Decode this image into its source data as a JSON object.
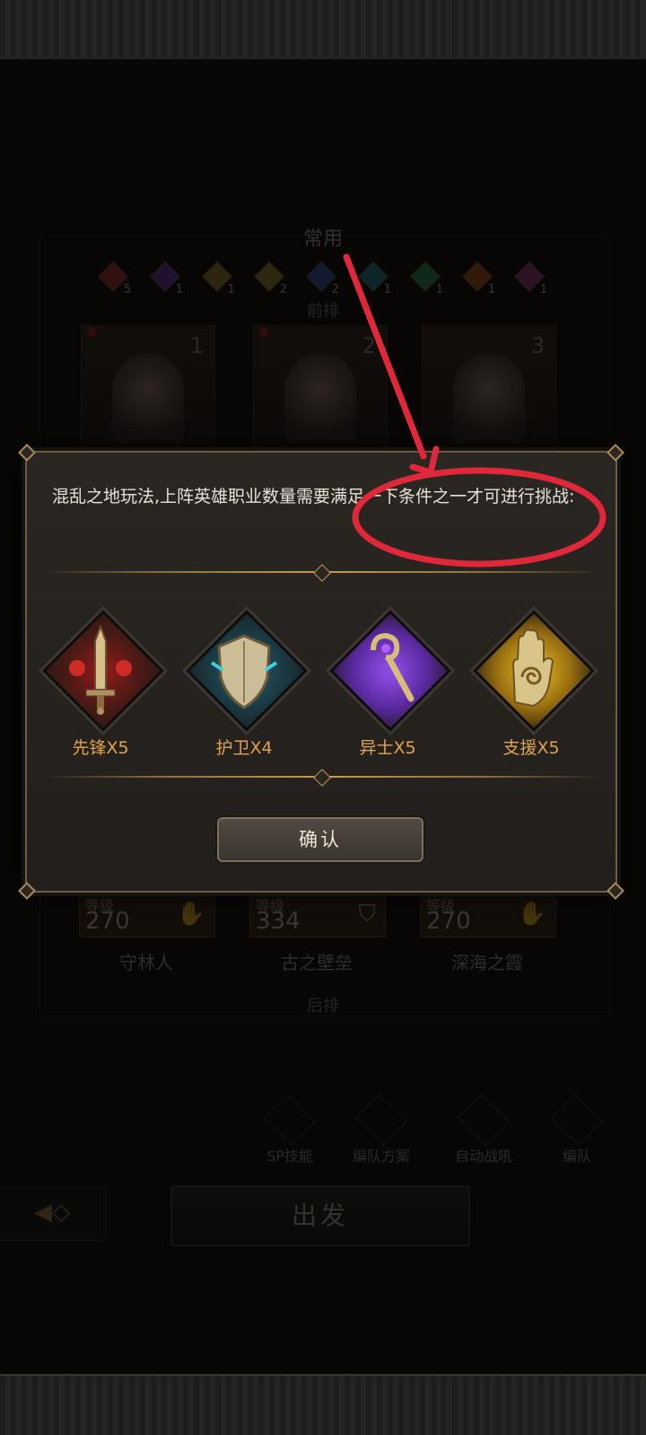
{
  "formation": {
    "section_title": "常用",
    "front_label": "前排",
    "back_label": "后排",
    "class_counts": [
      {
        "icon": "vanguard-red-icon",
        "count": "5",
        "color": "#b83a2a"
      },
      {
        "icon": "mage-purple-icon",
        "count": "1",
        "color": "#7a3ab0"
      },
      {
        "icon": "ranger-gold-icon",
        "count": "1",
        "color": "#a88a2a"
      },
      {
        "icon": "warrior-gold-icon",
        "count": "2",
        "color": "#b0902a"
      },
      {
        "icon": "assassin-blue-icon",
        "count": "2",
        "color": "#3a5ab0"
      },
      {
        "icon": "guardian-teal-icon",
        "count": "1",
        "color": "#2a8a9a"
      },
      {
        "icon": "healer-green-icon",
        "count": "1",
        "color": "#2a9a5a"
      },
      {
        "icon": "fire-orange-icon",
        "count": "1",
        "color": "#c05a1a"
      },
      {
        "icon": "support-pink-icon",
        "count": "1",
        "color": "#b03a8a"
      }
    ],
    "heroes_front": [
      {
        "slot": "1"
      },
      {
        "slot": "2"
      },
      {
        "slot": "3"
      }
    ],
    "heroes_back": [
      {
        "level_label": "等级",
        "level": "270",
        "name": "守林人",
        "class_icon": "✋"
      },
      {
        "level_label": "等级",
        "level": "334",
        "name": "古之壁垒",
        "class_icon": "⛉"
      },
      {
        "level_label": "等级",
        "level": "270",
        "name": "深海之霞",
        "class_icon": "✋"
      }
    ]
  },
  "toolbar": {
    "sp_skill": "SP技能",
    "team_plan": "编队方案",
    "auto_battle": "自动战吼",
    "formation": "编队"
  },
  "depart_label": "出发",
  "dialog": {
    "message": "混乱之地玩法,上阵英雄职业数量需要满足一下条件之一才可进行挑战:",
    "conditions": [
      {
        "icon": "sword-icon",
        "label": "先锋X5",
        "color": "#c22a2a"
      },
      {
        "icon": "shield-icon",
        "label": "护卫X4",
        "color": "#2ab0c0"
      },
      {
        "icon": "staff-icon",
        "label": "异士X5",
        "color": "#8a3ad0"
      },
      {
        "icon": "hand-icon",
        "label": "支援X5",
        "color": "#e0b020"
      }
    ],
    "confirm_label": "确认"
  },
  "colors": {
    "accent_gold": "#e2a44a",
    "annotation_red": "#e0283a"
  }
}
